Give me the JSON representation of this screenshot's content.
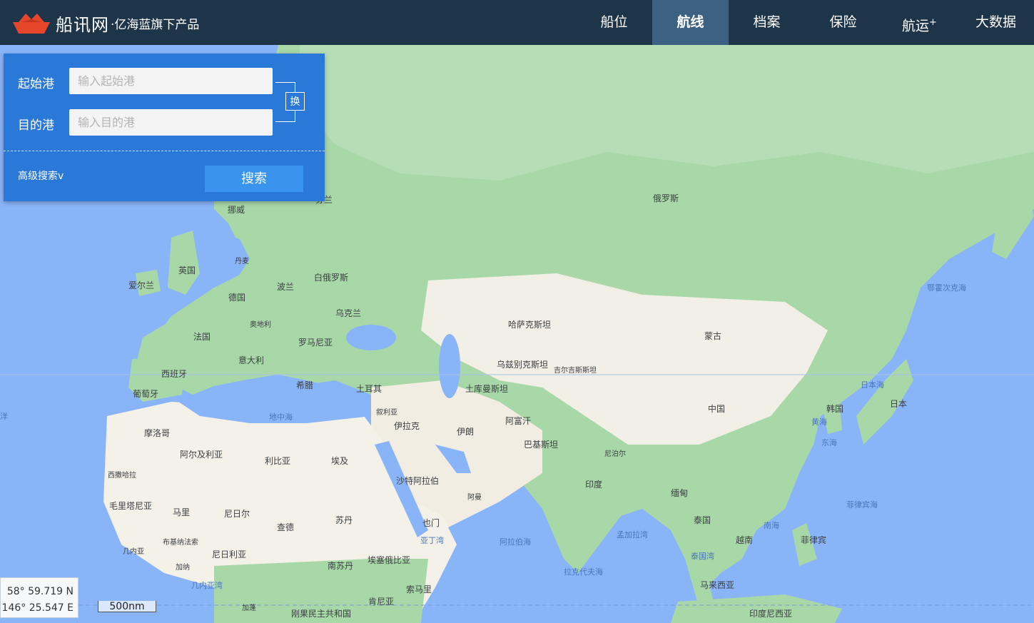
{
  "header": {
    "brand": "船讯网",
    "slogan": "·亿海蓝旗下产品",
    "nav": [
      {
        "label": "船位"
      },
      {
        "label": "航线",
        "active": true
      },
      {
        "label": "档案"
      },
      {
        "label": "保险"
      },
      {
        "label": "航运",
        "sup": "+"
      },
      {
        "label": "大数据"
      }
    ]
  },
  "route_panel": {
    "origin_label": "起始港",
    "origin_placeholder": "输入起始港",
    "dest_label": "目的港",
    "dest_placeholder": "输入目的港",
    "swap_label": "换",
    "advanced_label": "高级搜索v",
    "search_label": "搜索"
  },
  "coordinates": {
    "lat": "58° 59.719 N",
    "lon": "146° 25.547 E"
  },
  "scale": {
    "label": "500nm"
  },
  "map_labels": {
    "countries": [
      "俄罗斯",
      "哈萨克斯坦",
      "蒙古",
      "中国",
      "日本",
      "韩国",
      "印度",
      "伊朗",
      "阿富汗",
      "巴基斯坦",
      "土库曼斯坦",
      "乌兹别克斯坦",
      "吉尔吉斯斯坦",
      "尼泊尔",
      "缅甸",
      "泰国",
      "越南",
      "菲律宾",
      "马来西亚",
      "印度尼西亚",
      "土耳其",
      "叙利亚",
      "伊拉克",
      "沙特阿拉伯",
      "阿曼",
      "也门",
      "埃及",
      "利比亚",
      "阿尔及利亚",
      "摩洛哥",
      "西撒哈拉",
      "毛里塔尼亚",
      "马里",
      "尼日尔",
      "乍得",
      "苏丹",
      "南苏丹",
      "埃塞俄比亚",
      "索马里",
      "肯尼亚",
      "尼日利亚",
      "布基纳法索",
      "几内亚",
      "加纳",
      "加蓬",
      "刚果民主共和国",
      "西班牙",
      "葡萄牙",
      "法国",
      "意大利",
      "德国",
      "奥地利",
      "波兰",
      "白俄罗斯",
      "乌克兰",
      "罗马尼亚",
      "希腊",
      "丹麦",
      "挪威",
      "芬兰",
      "英国",
      "爱尔兰"
    ],
    "seas": [
      "鄂霍次克海",
      "日本海",
      "黄海",
      "东海",
      "南海",
      "菲律宾海",
      "孟加拉湾",
      "阿拉伯海",
      "拉克代夫海",
      "泰国湾",
      "亚丁湾",
      "地中海",
      "几内亚湾",
      "洋"
    ]
  }
}
